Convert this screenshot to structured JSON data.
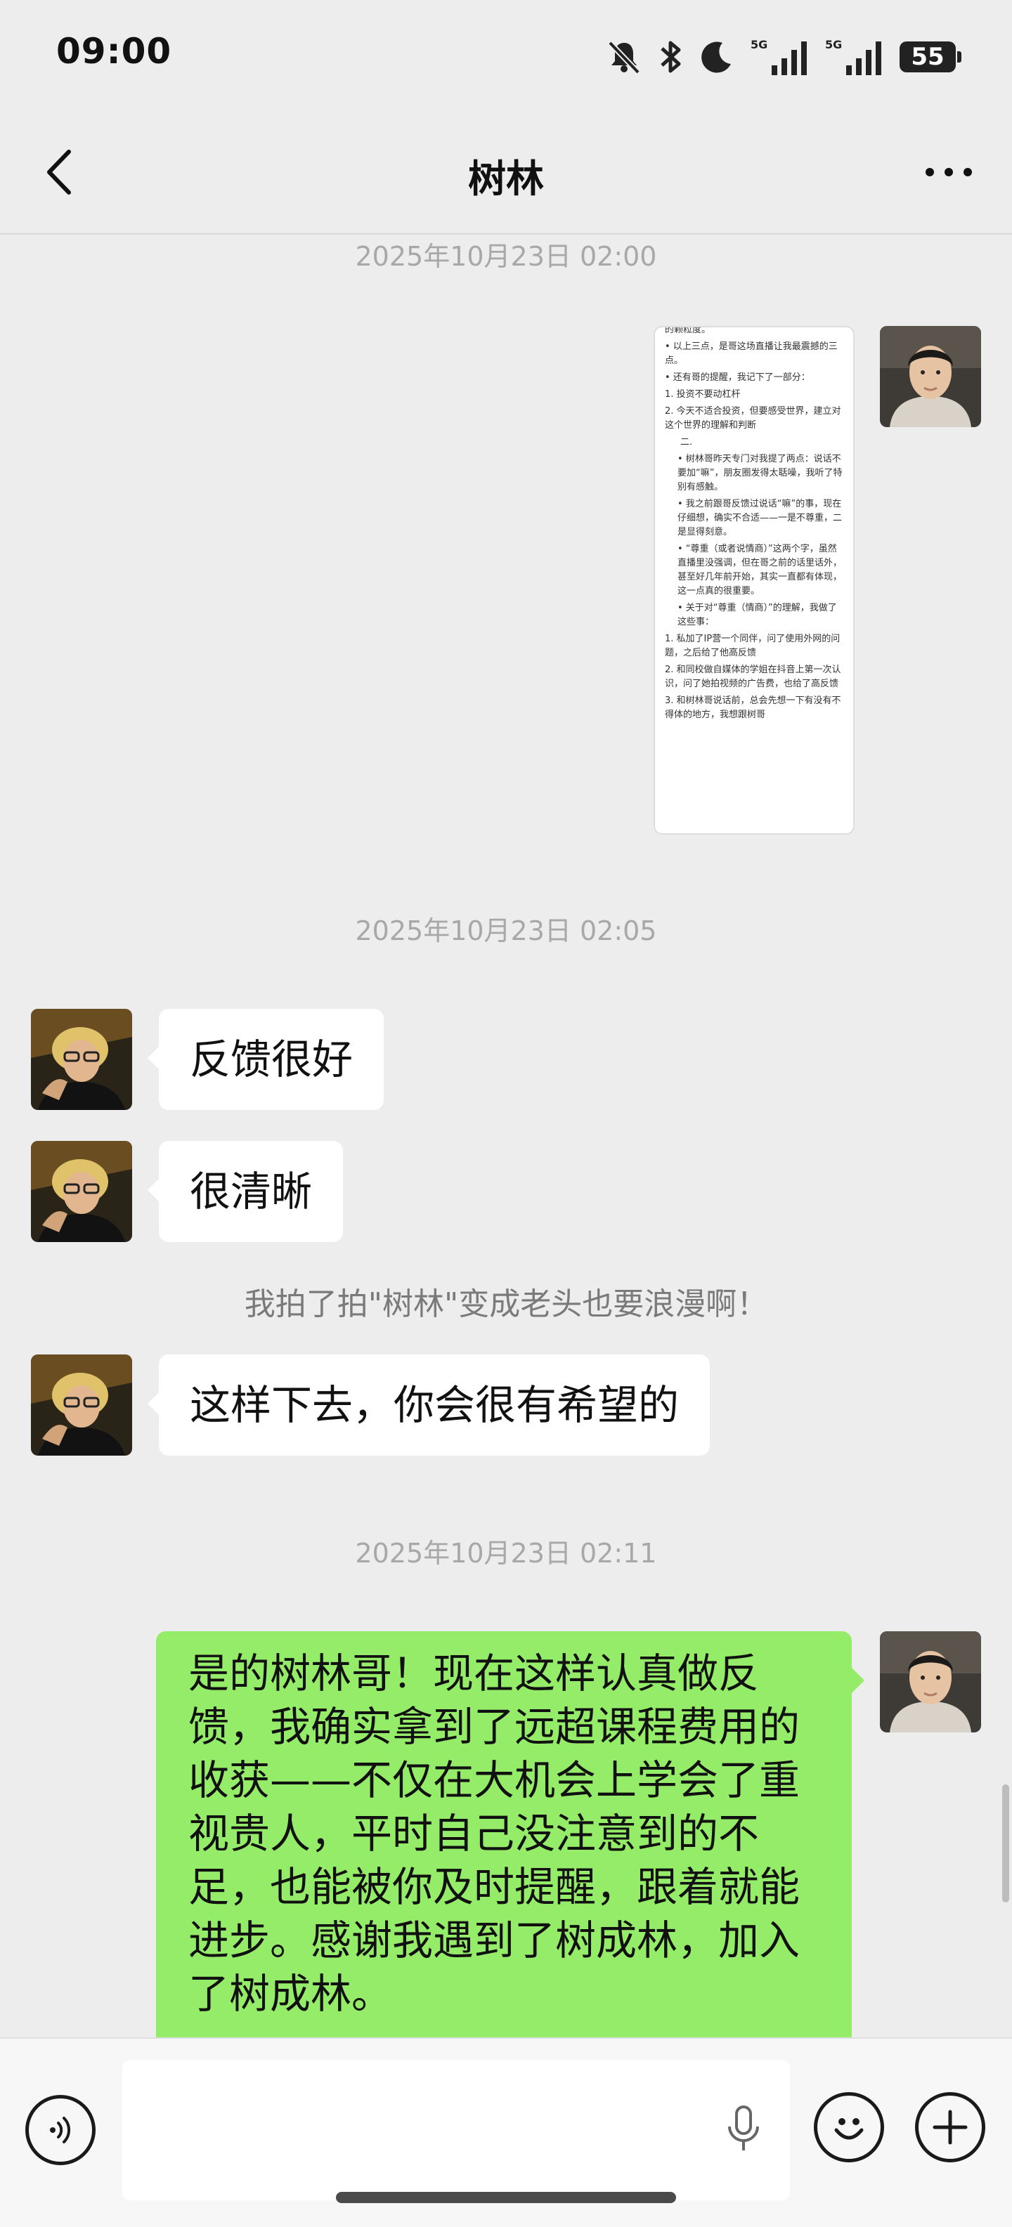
{
  "status_bar": {
    "time": "09:00",
    "battery": "55",
    "icons": [
      "mute-bell-icon",
      "bluetooth-icon",
      "moon-icon",
      "signal-5g-icon",
      "signal-5g-icon",
      "battery-icon"
    ]
  },
  "nav": {
    "title": "树林",
    "back_icon": "chevron-left-icon",
    "more_icon": "ellipsis-icon"
  },
  "messages": {
    "ts1": "2025年10月23日 02:00",
    "ts2": "2025年10月23日 02:05",
    "ts3": "2025年10月23日 02:11",
    "in1": "反馈很好",
    "in2": "很清晰",
    "system_pat": "我拍了拍\"树林\"变成老头也要浪漫啊！",
    "in3": "这样下去，你会很有希望的",
    "out1": "是的树林哥！现在这样认真做反馈，我确实拿到了远超课程费用的收获——不仅在大机会上学会了重视贵人，平时自己没注意到的不足，也能被你及时提醒，跟着就能进步。感谢我遇到了树成林，加入了树成林。"
  },
  "image_message": {
    "lines": [
      "的颗粒度。",
      "• 以上三点，是哥这场直播让我最震撼的三点。",
      "• 还有哥的提醒，我记下了一部分：",
      "1. 投资不要动杠杆",
      "2. 今天不适合投资，但要感受世界，建立对这个世界的理解和判断",
      "二.",
      "• 树林哥昨天专门对我提了两点：说话不要加“嘛”，朋友圈发得太聒噪，我听了特别有感触。",
      "• 我之前跟哥反馈过说话“嘛”的事，现在仔细想，确实不合适——一是不尊重，二是显得刻意。",
      "• “尊重（或者说情商）”这两个字，虽然直播里没强调，但在哥之前的话里话外，甚至好几年前开始，其实一直都有体现，这一点真的很重要。",
      "• 关于对“尊重（情商）”的理解，我做了这些事：",
      "1. 私加了IP营一个同伴，问了使用外网的问题，之后给了他高反馈",
      "2. 和同校做自媒体的学姐在抖音上第一次认识，问了她拍视频的广告费，也给了高反馈",
      "3. 和树林哥说话前，总会先想一下有没有不得体的地方，我想跟树哥"
    ]
  },
  "input_bar": {
    "placeholder": "",
    "voice_icon": "voice-wave-icon",
    "mic_icon": "microphone-icon",
    "emoji_icon": "emoji-face-icon",
    "plus_icon": "plus-icon"
  },
  "colors": {
    "background": "#ededed",
    "bubble_out": "#95ec69",
    "bubble_in": "#ffffff",
    "timestamp": "#a8a8a8"
  }
}
